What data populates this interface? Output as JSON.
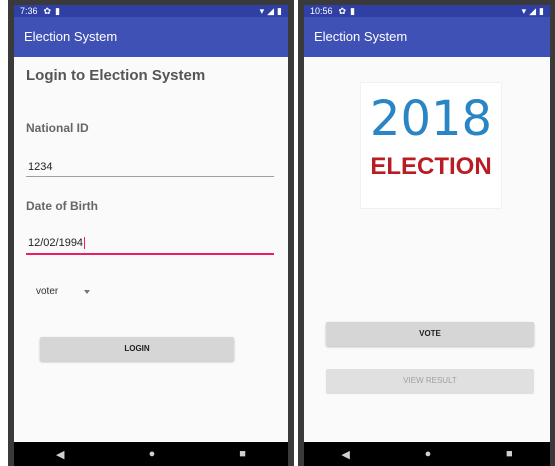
{
  "left_phone": {
    "status": {
      "time": "7:36"
    },
    "app_title": "Election System",
    "login_title": "Login to Election System",
    "national_id": {
      "label": "National ID",
      "value": "1234"
    },
    "dob": {
      "label": "Date of Birth",
      "value": "12/02/1994"
    },
    "role_select": {
      "selected": "voter"
    },
    "login_button": "LOGIN"
  },
  "right_phone": {
    "status": {
      "time": "10:56"
    },
    "app_title": "Election System",
    "logo": {
      "year": "2018",
      "word": "ELECTION"
    },
    "vote_button": "VOTE",
    "view_result_button": "VIEW RESULT"
  },
  "nav_icons": [
    "back-icon",
    "home-icon",
    "recents-icon"
  ],
  "colors": {
    "app_bar": "#3f51b5",
    "status_bar": "#2f3fa3",
    "accent": "#e91e63",
    "logo_blue": "#2a85c5",
    "logo_red": "#b81d24"
  }
}
